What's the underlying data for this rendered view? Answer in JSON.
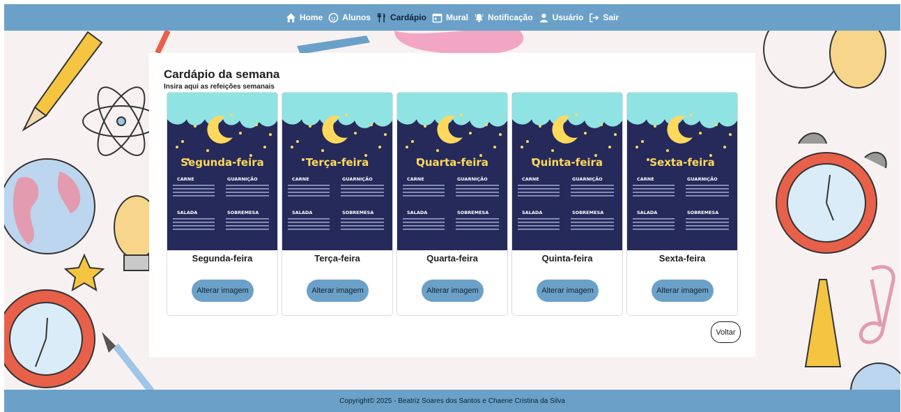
{
  "nav": {
    "items": [
      {
        "label": "Home",
        "icon": "home-icon"
      },
      {
        "label": "Alunos",
        "icon": "child-face-icon"
      },
      {
        "label": "Cardápio",
        "icon": "utensils-icon"
      },
      {
        "label": "Mural",
        "icon": "calendar-icon"
      },
      {
        "label": "Notificação",
        "icon": "bell-ring-icon"
      },
      {
        "label": "Usuário",
        "icon": "user-icon"
      },
      {
        "label": "Sair",
        "icon": "logout-icon"
      }
    ],
    "active": "Cardápio"
  },
  "page": {
    "title": "Cardápio da semana",
    "subtitle": "Insira aqui as refeições semanais"
  },
  "menu_sections": {
    "carne": "CARNE",
    "guarnicao": "GUARNIÇÃO",
    "salada": "SALADA",
    "sobremesa": "SOBREMESA"
  },
  "days": [
    {
      "name": "Segunda-feira",
      "image_title": "Segunda-feira",
      "button": "Alterar imagem"
    },
    {
      "name": "Terça-feira",
      "image_title": "Terça-feira",
      "button": "Alterar imagem"
    },
    {
      "name": "Quarta-feira",
      "image_title": "Quarta-feira",
      "button": "Alterar imagem"
    },
    {
      "name": "Quinta-feira",
      "image_title": "Quinta-feira",
      "button": "Alterar imagem"
    },
    {
      "name": "Sexta-feira",
      "image_title": "Sexta-feira",
      "button": "Alterar imagem"
    }
  ],
  "actions": {
    "back_label": "Voltar"
  },
  "footer": {
    "text": "Copyright© 2025 - Beatriz Soares dos Santos e Chaene Cristina da Silva"
  },
  "colors": {
    "nav_bar": "#6ba1c8",
    "menu_background": "#252a5a",
    "menu_title": "#ffd85c",
    "cloud": "#8fe3e3",
    "button": "#6ba1c8"
  }
}
